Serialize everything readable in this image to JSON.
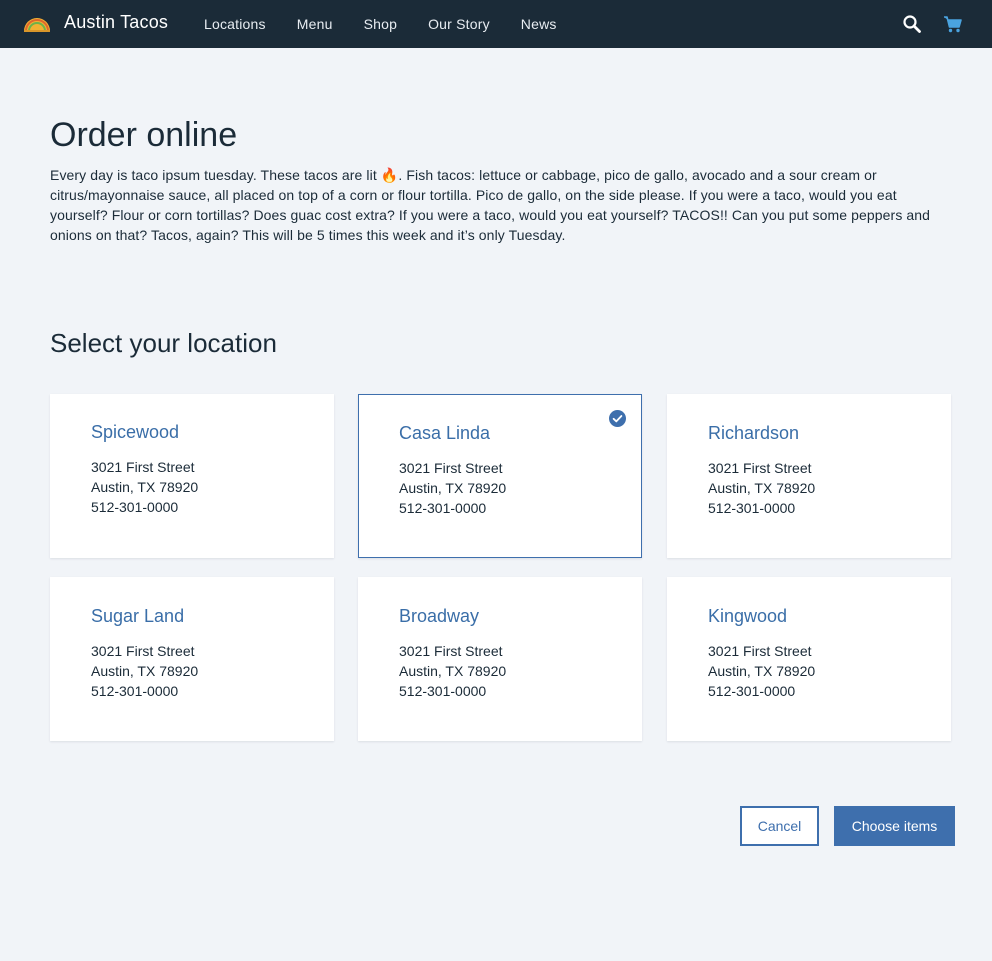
{
  "header": {
    "brand": "Austin Tacos",
    "logo_icon": "taco-icon",
    "nav": [
      "Locations",
      "Menu",
      "Shop",
      "Our Story",
      "News"
    ],
    "search_icon": "search-icon",
    "cart_icon": "cart-icon"
  },
  "main": {
    "title": "Order online",
    "intro_before": "Every day is taco ipsum tuesday. These tacos are lit ",
    "intro_emoji": "🔥",
    "intro_after": ". Fish tacos: lettuce or cabbage, pico de gallo, avocado and a sour cream or citrus/mayonnaise sauce, all placed on top of a corn or flour tortilla. Pico de gallo, on the side please. If you were a taco, would you eat yourself? Flour or corn tortillas? Does guac cost extra? If you were a taco, would you eat yourself? TACOS!! Can you put some peppers and onions on that? Tacos, again? This will be 5 times this week and it’s only Tuesday.",
    "section_title": "Select your location"
  },
  "locations": [
    {
      "name": "Spicewood",
      "street": "3021 First Street",
      "city": "Austin, TX 78920",
      "phone": "512-301-0000",
      "selected": false
    },
    {
      "name": "Casa Linda",
      "street": "3021 First Street",
      "city": "Austin, TX 78920",
      "phone": "512-301-0000",
      "selected": true
    },
    {
      "name": "Richardson",
      "street": "3021 First Street",
      "city": "Austin, TX 78920",
      "phone": "512-301-0000",
      "selected": false
    },
    {
      "name": "Sugar Land",
      "street": "3021 First Street",
      "city": "Austin, TX 78920",
      "phone": "512-301-0000",
      "selected": false
    },
    {
      "name": "Broadway",
      "street": "3021 First Street",
      "city": "Austin, TX 78920",
      "phone": "512-301-0000",
      "selected": false
    },
    {
      "name": "Kingwood",
      "street": "3021 First Street",
      "city": "Austin, TX 78920",
      "phone": "512-301-0000",
      "selected": false
    }
  ],
  "actions": {
    "cancel": "Cancel",
    "primary": "Choose items"
  },
  "colors": {
    "header_bg": "#1b2b38",
    "page_bg": "#f1f4f8",
    "accent": "#3e6fad",
    "cart": "#4aa3df"
  }
}
